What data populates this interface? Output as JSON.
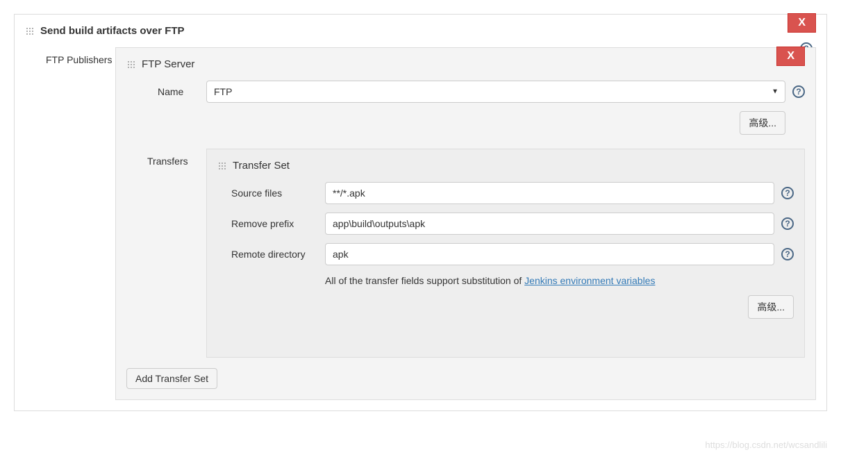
{
  "main": {
    "title": "Send build artifacts over FTP",
    "close_label": "X"
  },
  "publishers": {
    "label": "FTP Publishers"
  },
  "server": {
    "title": "FTP Server",
    "close_label": "X",
    "name_label": "Name",
    "name_value": "FTP",
    "advanced_label": "高级..."
  },
  "transfers": {
    "label": "Transfers",
    "set_title": "Transfer Set",
    "source_label": "Source files",
    "source_value": "**/*.apk",
    "prefix_label": "Remove prefix",
    "prefix_value": "app\\build\\outputs\\apk",
    "remote_label": "Remote directory",
    "remote_value": "apk",
    "note_prefix": "All of the transfer fields support substitution of ",
    "note_link": "Jenkins environment variables",
    "advanced_label": "高级...",
    "add_label": "Add Transfer Set"
  },
  "watermark": "https://blog.csdn.net/wcsandlili"
}
